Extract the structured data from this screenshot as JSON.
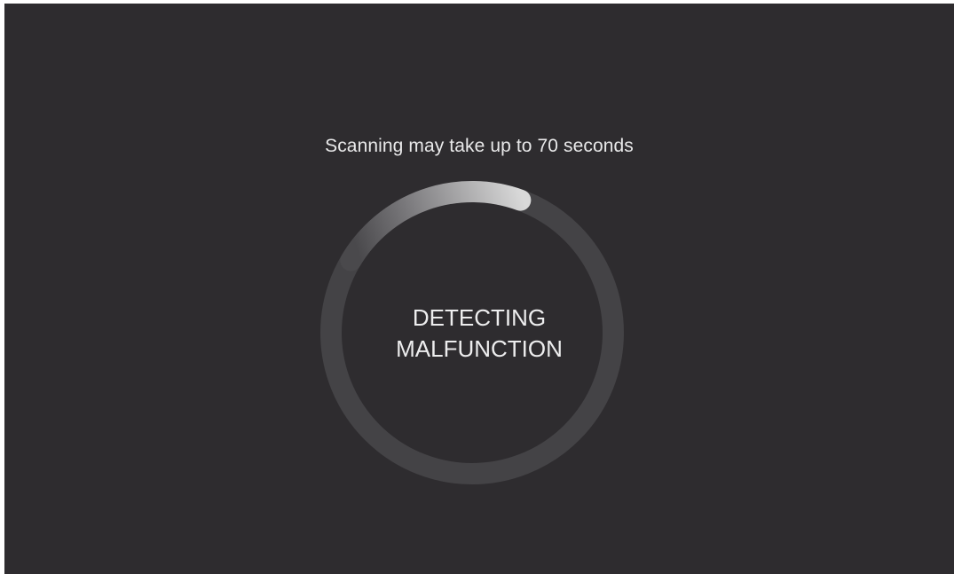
{
  "scan": {
    "hint": "Scanning may take up to 70 seconds",
    "status_line1": "DETECTING",
    "status_line2": "MALFUNCTION",
    "progress_fraction": 0.22
  },
  "colors": {
    "background": "#2e2c2f",
    "track": "#444346",
    "progress_start": "#4a494c",
    "progress_end": "#d8d8d8",
    "text": "#ececed"
  }
}
